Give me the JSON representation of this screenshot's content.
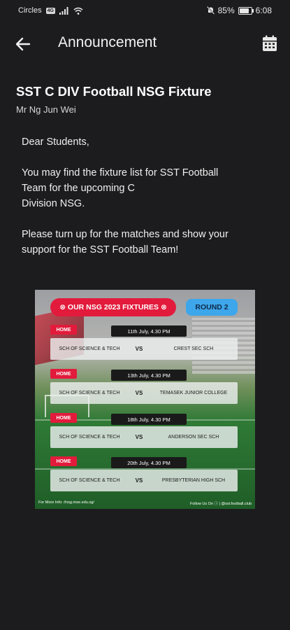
{
  "status_bar": {
    "carrier": "Circles",
    "carrier_chip": "4G",
    "battery": "85%",
    "battery_level": 0.85,
    "time": "6:08"
  },
  "app_bar": {
    "title": "Announcement"
  },
  "post": {
    "title": "SST C DIV Football NSG Fixture",
    "author": "Mr Ng Jun Wei",
    "greeting": "Dear Students,",
    "para1_lines": [
      "You may find the fixture list for SST Football",
      "Team for the upcoming C",
      "Division NSG."
    ],
    "para2_lines": [
      "Please turn up for the matches and show your",
      "support for the SST Football Team!"
    ]
  },
  "poster": {
    "banner": "⊗ OUR NSG 2023 FIXTURES ⊗",
    "round": "ROUND 2",
    "fixtures": [
      {
        "tag": "HOME",
        "date": "11th July, 4.30 PM",
        "home": "SCH OF SCIENCE & TECH",
        "vs": "VS",
        "away": "CREST SEC SCH"
      },
      {
        "tag": "HOME",
        "date": "13th July, 4.30 PM",
        "home": "SCH OF SCIENCE & TECH",
        "vs": "VS",
        "away": "TEMASEK JUNIOR COLLEGE"
      },
      {
        "tag": "HOME",
        "date": "18th July, 4.30 PM",
        "home": "SCH OF SCIENCE & TECH",
        "vs": "VS",
        "away": "ANDERSON SEC SCH"
      },
      {
        "tag": "HOME",
        "date": "20th July, 4.30 PM",
        "home": "SCH OF SCIENCE & TECH",
        "vs": "VS",
        "away": "PRESBYTERIAN HIGH SCH"
      }
    ],
    "footer_left": "For More Info: //nsg.moe.edu.sg/",
    "footer_right": "Follow Us On ⓘ | @sst.football.club"
  },
  "colors": {
    "background": "#1c1c1e",
    "accent_red": "#e21b3c",
    "accent_blue": "#3ea6ea"
  },
  "icons": {
    "back": "arrow-left-icon",
    "calendar": "calendar-icon",
    "signal": "signal-icon",
    "wifi": "wifi-icon",
    "mute": "bell-off-icon",
    "battery": "battery-icon"
  }
}
